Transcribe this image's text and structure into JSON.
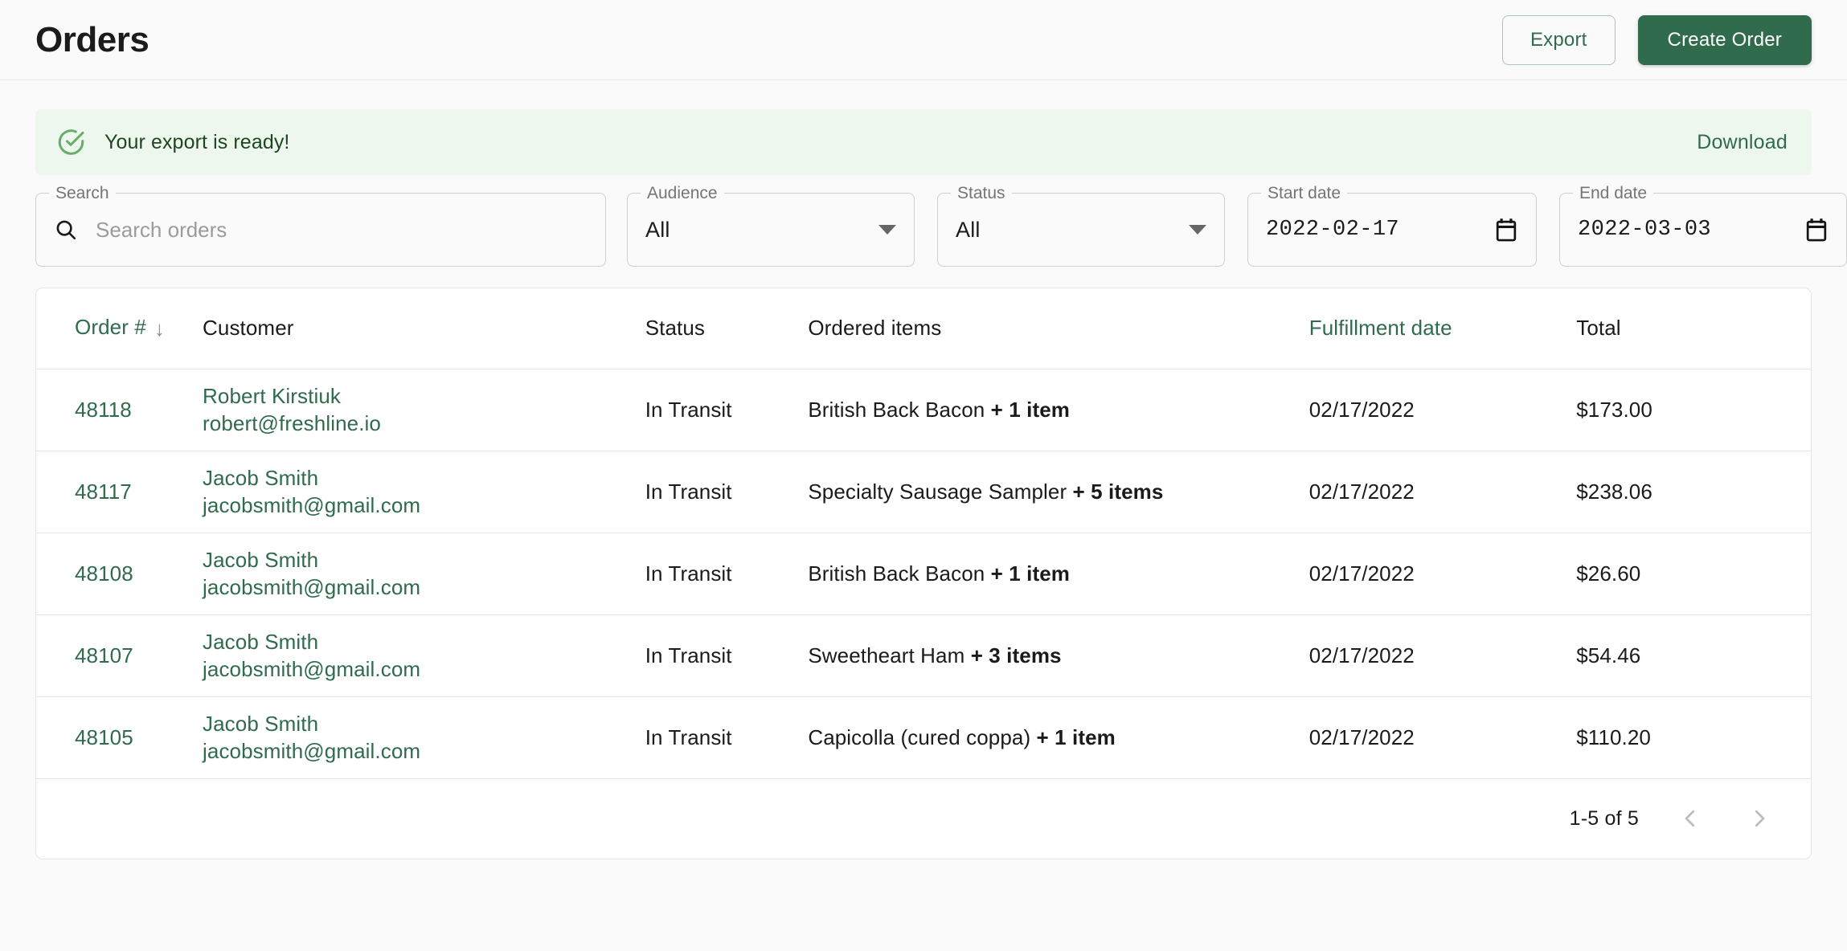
{
  "header": {
    "title": "Orders",
    "export_label": "Export",
    "create_label": "Create Order"
  },
  "alert": {
    "message": "Your export is ready!",
    "action_label": "Download",
    "icon": "check-circle-icon",
    "bg": "#edf7ed",
    "text_color": "#1e4620",
    "accent": "#2f6b4c"
  },
  "filters": {
    "search": {
      "legend": "Search",
      "placeholder": "Search orders",
      "value": "",
      "icon": "search-icon"
    },
    "audience": {
      "legend": "Audience",
      "value": "All",
      "icon": "chevron-down-icon"
    },
    "status": {
      "legend": "Status",
      "value": "All",
      "icon": "chevron-down-icon"
    },
    "start_date": {
      "legend": "Start date",
      "value": "2022-02-17",
      "icon": "calendar-icon"
    },
    "end_date": {
      "legend": "End date",
      "value": "2022-03-03",
      "icon": "calendar-icon"
    }
  },
  "table": {
    "columns": [
      {
        "label": "Order #",
        "sortable": true,
        "sort_dir": "desc",
        "sort_glyph": "↓"
      },
      {
        "label": "Customer",
        "sortable": false
      },
      {
        "label": "Status",
        "sortable": false
      },
      {
        "label": "Ordered items",
        "sortable": false
      },
      {
        "label": "Fulfillment date",
        "sortable": true
      },
      {
        "label": "Total",
        "sortable": false
      }
    ],
    "rows": [
      {
        "order": "48118",
        "customer_name": "Robert Kirstiuk",
        "customer_email": "robert@freshline.io",
        "status": "In Transit",
        "item": "British Back Bacon",
        "extra_items": "+ 1 item",
        "fulfillment_date": "02/17/2022",
        "total": "$173.00"
      },
      {
        "order": "48117",
        "customer_name": "Jacob Smith",
        "customer_email": "jacobsmith@gmail.com",
        "status": "In Transit",
        "item": "Specialty Sausage Sampler",
        "extra_items": "+ 5 items",
        "fulfillment_date": "02/17/2022",
        "total": "$238.06"
      },
      {
        "order": "48108",
        "customer_name": "Jacob Smith",
        "customer_email": "jacobsmith@gmail.com",
        "status": "In Transit",
        "item": "British Back Bacon",
        "extra_items": "+ 1 item",
        "fulfillment_date": "02/17/2022",
        "total": "$26.60"
      },
      {
        "order": "48107",
        "customer_name": "Jacob Smith",
        "customer_email": "jacobsmith@gmail.com",
        "status": "In Transit",
        "item": "Sweetheart Ham",
        "extra_items": "+ 3 items",
        "fulfillment_date": "02/17/2022",
        "total": "$54.46"
      },
      {
        "order": "48105",
        "customer_name": "Jacob Smith",
        "customer_email": "jacobsmith@gmail.com",
        "status": "In Transit",
        "item": "Capicolla (cured coppa)",
        "extra_items": "+ 1 item",
        "fulfillment_date": "02/17/2022",
        "total": "$110.20"
      }
    ]
  },
  "pagination": {
    "label": "1-5 of 5",
    "prev_icon": "chevron-left-icon",
    "next_icon": "chevron-right-icon"
  },
  "theme": {
    "brand_green": "#2f6b4c",
    "page_bg": "#fafafa",
    "surface": "#ffffff",
    "border": "#e4e4e4"
  }
}
